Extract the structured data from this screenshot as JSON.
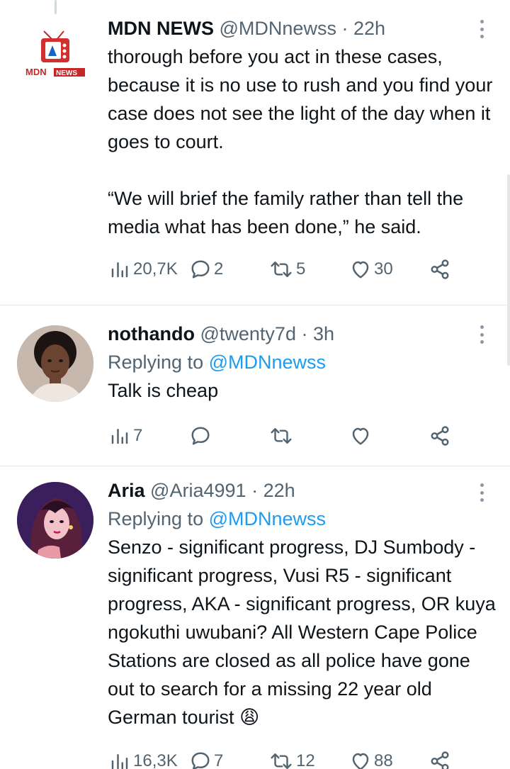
{
  "tweets": [
    {
      "author": "MDN NEWS",
      "handle": "@MDNnewss",
      "dot": "·",
      "time": "22h",
      "avatar_logo_text": "MDN",
      "avatar_logo_badge": "NEWS",
      "text": "thorough before you act in these cases, because it is no use to rush and you find your case does not see the light of the day when it goes to court.\n\n“We will brief the family rather than tell the media what has been done,” he said.",
      "views": "20,7K",
      "replies": "2",
      "retweets": "5",
      "likes": "30"
    },
    {
      "author": "nothando",
      "handle": "@twenty7d",
      "dot": "·",
      "time": "3h",
      "replying_label": "Replying to",
      "replying_to": "@MDNnewss",
      "text": "Talk is cheap",
      "views": "7",
      "replies": "",
      "retweets": "",
      "likes": ""
    },
    {
      "author": "Aria",
      "handle": "@Aria4991",
      "dot": "·",
      "time": "22h",
      "replying_label": "Replying to",
      "replying_to": "@MDNnewss",
      "text": "Senzo - significant progress, DJ Sumbody - significant progress, Vusi R5 - significant progress, AKA - significant progress, OR kuya ngokuthi uwubani? All Western Cape Police Stations are closed as all police have gone out to search for a missing 22 year old German tourist",
      "emoji": "😩",
      "views": "16,3K",
      "replies": "7",
      "retweets": "12",
      "likes": "88"
    }
  ],
  "icons": {
    "views": "bar-chart-icon",
    "reply": "speech-bubble-icon",
    "retweet": "retweet-icon",
    "like": "heart-icon",
    "share": "share-icon",
    "menu": "more-vertical-icon"
  },
  "colors": {
    "text": "#0f1419",
    "secondary": "#536471",
    "link": "#1d9bf0",
    "divider": "#e5e9eb",
    "mdn_red": "#d32f2f"
  }
}
